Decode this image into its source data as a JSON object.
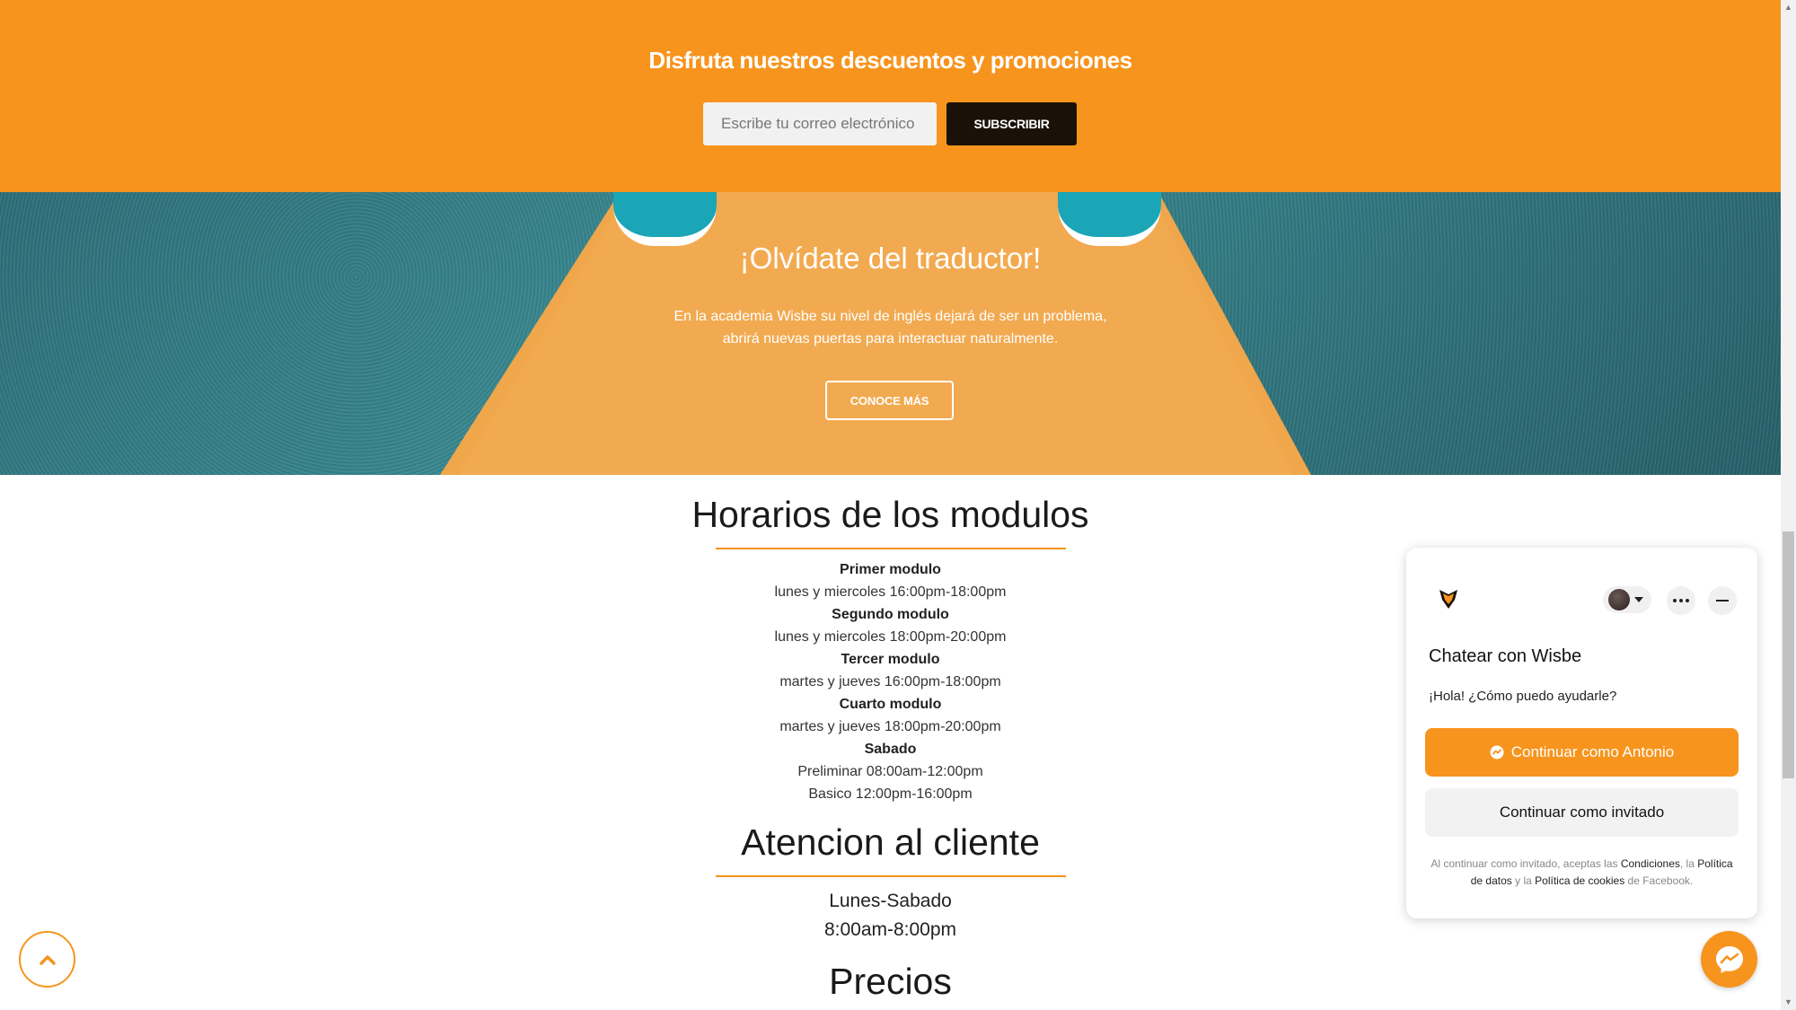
{
  "promo": {
    "title": "Disfruta nuestros descuentos y promociones",
    "email_placeholder": "Escribe tu correo electrónico",
    "subscribe_label": "SUBSCRIBIR"
  },
  "hero": {
    "title": "¡Olvídate del traductor!",
    "text_line1": "En la academia Wisbe su nivel de inglés dejará de ser un problema,",
    "text_line2": "abrirá nuevas puertas para interactuar naturalmente.",
    "cta_label": "CONOCE MÁS"
  },
  "schedule": {
    "title": "Horarios de los modulos",
    "modules": [
      {
        "name": "Primer modulo",
        "times": [
          "lunes y miercoles 16:00pm-18:00pm"
        ]
      },
      {
        "name": "Segundo modulo",
        "times": [
          "lunes y miercoles 18:00pm-20:00pm"
        ]
      },
      {
        "name": "Tercer modulo",
        "times": [
          "martes y jueves 16:00pm-18:00pm"
        ]
      },
      {
        "name": "Cuarto modulo",
        "times": [
          "martes y jueves 18:00pm-20:00pm"
        ]
      },
      {
        "name": "Sabado",
        "times": [
          "Preliminar 08:00am-12:00pm",
          "Basico 12:00pm-16:00pm"
        ]
      }
    ]
  },
  "atencion": {
    "title": "Atencion al cliente",
    "days": "Lunes-Sabado",
    "hours": "8:00am-8:00pm"
  },
  "precios": {
    "title": "Precios"
  },
  "chat": {
    "title": "Chatear con Wisbe",
    "greeting": "¡Hola! ¿Cómo puedo ayudarle?",
    "continue_as_user": "Continuar como Antonio",
    "continue_as_guest": "Continuar como invitado",
    "legal_prefix": "Al continuar como invitado, aceptas las",
    "legal_terms": "Condiciones",
    "legal_sep1": ", la",
    "legal_data": "Política de datos",
    "legal_sep2": "y la",
    "legal_cookies": "Política de cookies",
    "legal_suffix": "de Facebook."
  },
  "colors": {
    "accent": "#f7941d",
    "dark": "#1a1208"
  },
  "icons": [
    "chevron-up-icon",
    "messenger-icon",
    "wisbe-logo-icon",
    "more-icon",
    "minimize-icon",
    "caret-down-icon"
  ]
}
